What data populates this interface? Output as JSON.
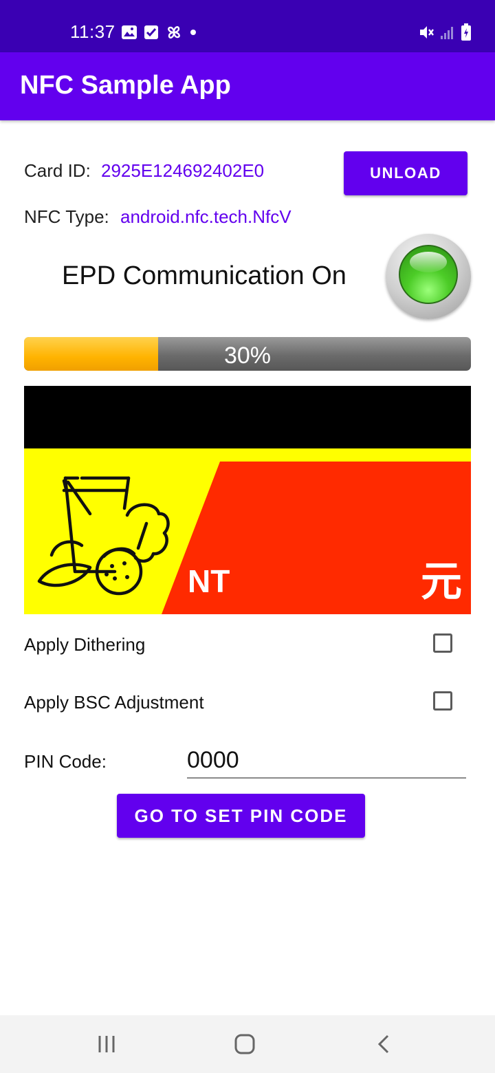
{
  "status_bar": {
    "time": "11:37",
    "icons": [
      "image-icon",
      "checkbox-icon",
      "pinwheel-icon",
      "dot-icon",
      "mute-icon",
      "signal-icon",
      "battery-icon"
    ]
  },
  "app_bar": {
    "title": "NFC Sample App"
  },
  "card": {
    "card_id_label": "Card ID:",
    "card_id_value": "2925E124692402E0",
    "nfc_type_label": "NFC Type:",
    "nfc_type_value": "android.nfc.tech.NfcV",
    "unload_label": "UNLOAD"
  },
  "epd": {
    "status_text": "EPD Communication On",
    "led_color": "#4ccc27"
  },
  "progress": {
    "percent": 30,
    "text": "30%"
  },
  "preview": {
    "nt_text": "NT",
    "currency_text": "元",
    "colors": {
      "black": "#000000",
      "yellow": "#ffff00",
      "red": "#ff2a00"
    }
  },
  "options": {
    "dithering_label": "Apply Dithering",
    "dithering_checked": false,
    "bsc_label": "Apply BSC Adjustment",
    "bsc_checked": false
  },
  "pin": {
    "label": "PIN Code:",
    "value": "0000",
    "button_label": "GO TO SET PIN CODE"
  },
  "nav_bar": {
    "icons": [
      "recents-icon",
      "home-icon",
      "back-icon"
    ]
  },
  "colors": {
    "status_bar": "#3a00b3",
    "primary": "#6200ee"
  }
}
